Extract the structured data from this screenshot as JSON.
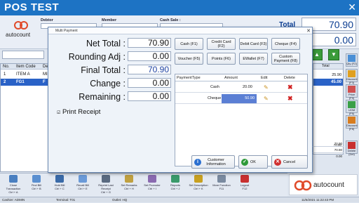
{
  "window": {
    "title": "POS TEST",
    "close": "✕"
  },
  "header": {
    "debtor_label": "Debtor",
    "member_label": "Member",
    "cash_sale_label": "Cash Sale :",
    "total_label": "Total",
    "total_value": "70.90",
    "change_value": "0.00",
    "logo_text": "autocount"
  },
  "grid": {
    "columns": [
      "No.",
      "Item Code",
      "Descr",
      "Total"
    ],
    "rows": [
      {
        "no": "1",
        "code": "ITEM A",
        "desc": "MI",
        "total": "25.90"
      },
      {
        "no": "2",
        "code": "FG1",
        "desc": "F",
        "total": "45.00"
      }
    ],
    "right_values": [
      "70.90",
      "70.90",
      "70.90",
      "0.00"
    ]
  },
  "dialog": {
    "title": "Multi Payment",
    "net_total_label": "Net Total :",
    "net_total": "70.90",
    "rounding_label": "Rounding Adj :",
    "rounding": "0.00",
    "final_total_label": "Final Total :",
    "final_total": "70.90",
    "change_label": "Change :",
    "change": "0.00",
    "remaining_label": "Remaining :",
    "remaining": "0.00",
    "print_receipt": "Print Receipt",
    "pay_buttons": [
      "Cash (F1)",
      "Credit Card (F2)",
      "Debit Card (F3)",
      "Cheque (F4)",
      "Voucher (F5)",
      "Points (F6)",
      "EWallet (F7)",
      "Custom Payment (F8)"
    ],
    "table_headers": {
      "type": "PaymentType",
      "amount": "Amount",
      "edit": "Edit",
      "delete": "Delete"
    },
    "payments": [
      {
        "type": "Cash",
        "amount": "20.00"
      },
      {
        "type": "Cheque",
        "amount": "50.90"
      }
    ],
    "customer_info": "Customer Information",
    "ok": "OK",
    "cancel": "Cancel"
  },
  "side_buttons": [
    "Qty (F2)",
    "Discount (F3)",
    "Price (F5)",
    "UOM (F6)",
    "Discount (F8)",
    "Delete (Del)"
  ],
  "toolbar": [
    {
      "label": "Close Transaction",
      "key": "Ctrl + A"
    },
    {
      "label": "Find Bill",
      "key": "Ctrl + B"
    },
    {
      "label": "Hold Bill",
      "key": "Ctrl + C"
    },
    {
      "label": "Recall Bill",
      "key": "Ctrl + E"
    },
    {
      "label": "Reprint Last Receipt",
      "key": "Ctrl + G"
    },
    {
      "label": "Set Remarks",
      "key": "Ctrl + H"
    },
    {
      "label": "Set Promoter",
      "key": "Ctrl + I"
    },
    {
      "label": "Reports",
      "key": "Ctrl + J"
    },
    {
      "label": "Set Description",
      "key": "Ctrl + K"
    },
    {
      "label": "More Function",
      "key": "F11"
    },
    {
      "label": "Logout",
      "key": "F12"
    }
  ],
  "status": {
    "cashier": "Cashier: ADMIN",
    "terminal": "Terminal: T01",
    "outlet": "Outlet: HQ",
    "datetime": "11/6/2021 11:22:43 PM"
  },
  "colors": {
    "titlebar": "#1d73c4",
    "accent_blue": "#0b3d91",
    "selected_row": "#2a62c7"
  }
}
